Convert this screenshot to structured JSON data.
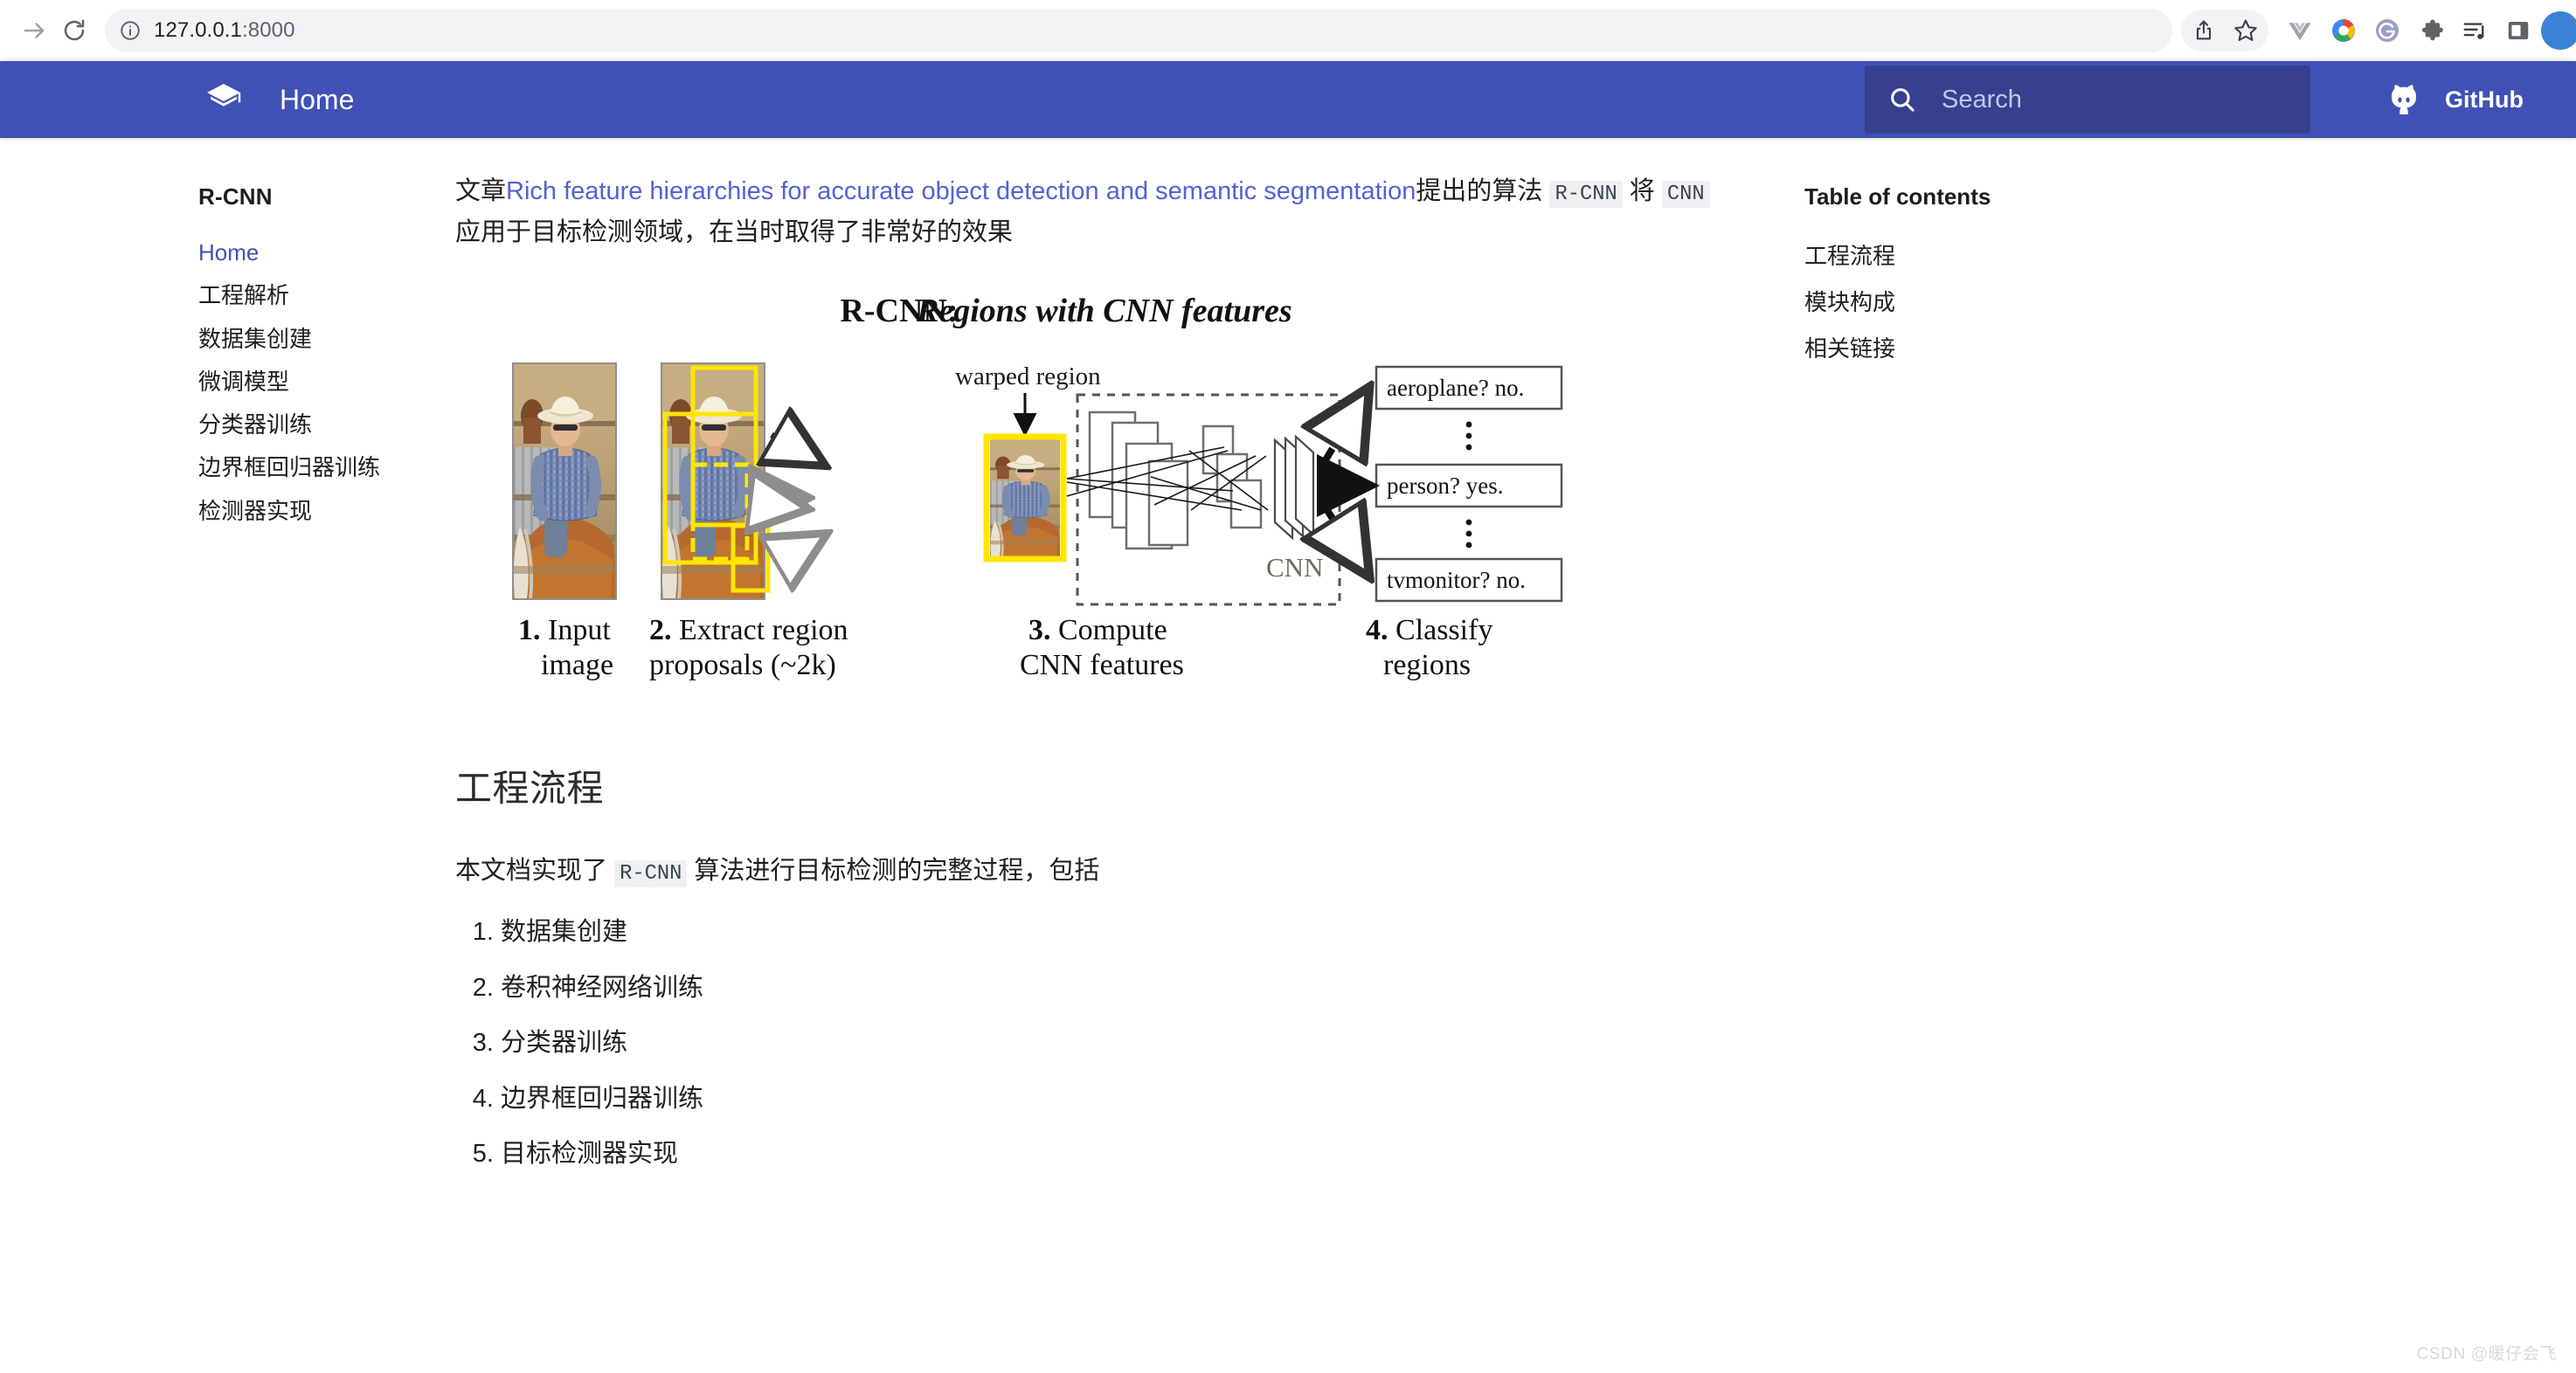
{
  "browser": {
    "url": "127.0.0.1:8000",
    "url_host": "127.0.0.1",
    "url_port": ":8000",
    "forward_icon": "forward-arrow-icon",
    "reload_icon": "reload-icon",
    "info_icon": "site-info-icon",
    "actions": [
      {
        "name": "share-icon",
        "label": "Share"
      },
      {
        "name": "bookmark-star-icon",
        "label": "Bookmark"
      },
      {
        "name": "vuejs-extension-icon",
        "label": "Vue.js devtools"
      },
      {
        "name": "color-circle-extension-icon",
        "label": "Extension"
      },
      {
        "name": "grammarly-extension-icon",
        "label": "Grammarly"
      },
      {
        "name": "puzzle-extensions-icon",
        "label": "Extensions"
      },
      {
        "name": "playlist-icon",
        "label": "Playlist"
      },
      {
        "name": "side-panel-icon",
        "label": "Side panel"
      },
      {
        "name": "profile-avatar",
        "label": "Profile"
      }
    ]
  },
  "header": {
    "logo_icon": "mkdocs-material-logo",
    "title": "Home",
    "search": {
      "placeholder": "Search",
      "value": "",
      "icon": "search-icon"
    },
    "repo": {
      "icon": "github-icon",
      "label": "GitHub"
    },
    "background_color": "#4051b5",
    "search_background_color": "#36408f"
  },
  "sidebar": {
    "title": "R-CNN",
    "items": [
      {
        "label": "Home",
        "active": true
      },
      {
        "label": "工程解析",
        "active": false
      },
      {
        "label": "数据集创建",
        "active": false
      },
      {
        "label": "微调模型",
        "active": false
      },
      {
        "label": "分类器训练",
        "active": false
      },
      {
        "label": "边界框回归器训练",
        "active": false
      },
      {
        "label": "检测器实现",
        "active": false
      }
    ],
    "active_color": "#4051b5"
  },
  "main": {
    "intro": {
      "prefix": "文章",
      "link_text": "Rich feature hierarchies for accurate object detection and semantic segmentation",
      "middle": "提出的算法 ",
      "code1": "R-CNN",
      "middle2": " 将 ",
      "code2": "CNN",
      "suffix": " 应用于目标检测领域，在当时取得了非常好的效果",
      "link_color": "#5362d6"
    },
    "figure": {
      "alt": "R-CNN: Regions with CNN features",
      "title_bold": "R-CNN:",
      "title_italic": "Regions with CNN features",
      "annotation_warped": "warped region",
      "annotation_cnn": "CNN",
      "classify_boxes": [
        "aeroplane? no.",
        "person? yes.",
        "tvmonitor? no."
      ],
      "steps": [
        {
          "num": "1.",
          "line1": "Input",
          "line2": "image"
        },
        {
          "num": "2.",
          "line1": "Extract region",
          "line2": "proposals (~2k)"
        },
        {
          "num": "3.",
          "line1": "Compute",
          "line2": "CNN features"
        },
        {
          "num": "4.",
          "line1": "Classify",
          "line2": "regions"
        }
      ]
    },
    "section_heading": "工程流程",
    "section_para": {
      "prefix": "本文档实现了 ",
      "code": "R-CNN",
      "suffix": " 算法进行目标检测的完整过程，包括"
    },
    "steps_list": [
      "数据集创建",
      "卷积神经网络训练",
      "分类器训练",
      "边界框回归器训练",
      "目标检测器实现"
    ]
  },
  "toc": {
    "title": "Table of contents",
    "items": [
      "工程流程",
      "模块构成",
      "相关链接"
    ]
  },
  "watermark": "CSDN @暖仔会飞"
}
